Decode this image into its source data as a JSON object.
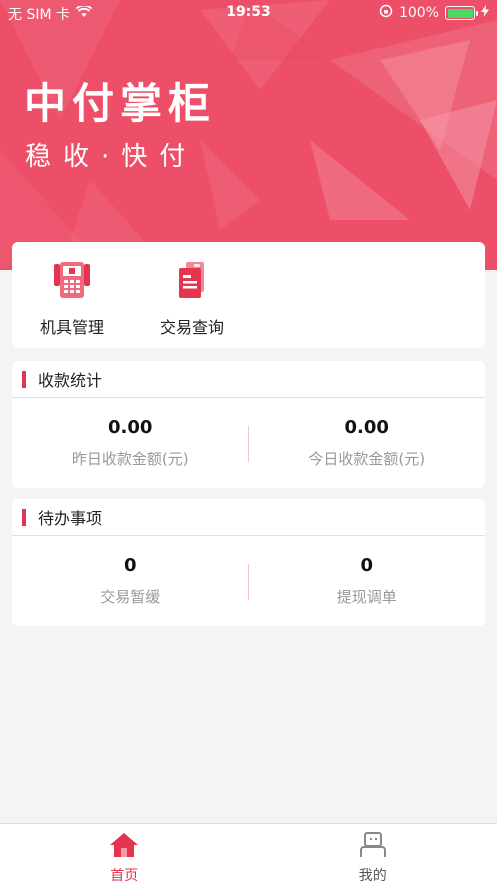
{
  "status_bar": {
    "carrier": "无 SIM 卡",
    "time": "19:53",
    "battery": "100%"
  },
  "hero": {
    "title": "中付掌柜",
    "slogan": "稳收·快付"
  },
  "quick_actions": [
    {
      "label": "机具管理",
      "icon": "pos-terminal-icon"
    },
    {
      "label": "交易查询",
      "icon": "receipt-search-icon"
    }
  ],
  "collection_stats": {
    "title": "收款统计",
    "yesterday": {
      "value": "0.00",
      "caption": "昨日收款金额(元)"
    },
    "today": {
      "value": "0.00",
      "caption": "今日收款金额(元)"
    }
  },
  "todo": {
    "title": "待办事项",
    "pending_trade": {
      "value": "0",
      "caption": "交易暂缓"
    },
    "withdraw_adjust": {
      "value": "0",
      "caption": "提现调单"
    }
  },
  "tabbar": {
    "home": "首页",
    "mine": "我的"
  },
  "colors": {
    "accent": "#e4344f",
    "hero_bg": "#ec4f67"
  }
}
